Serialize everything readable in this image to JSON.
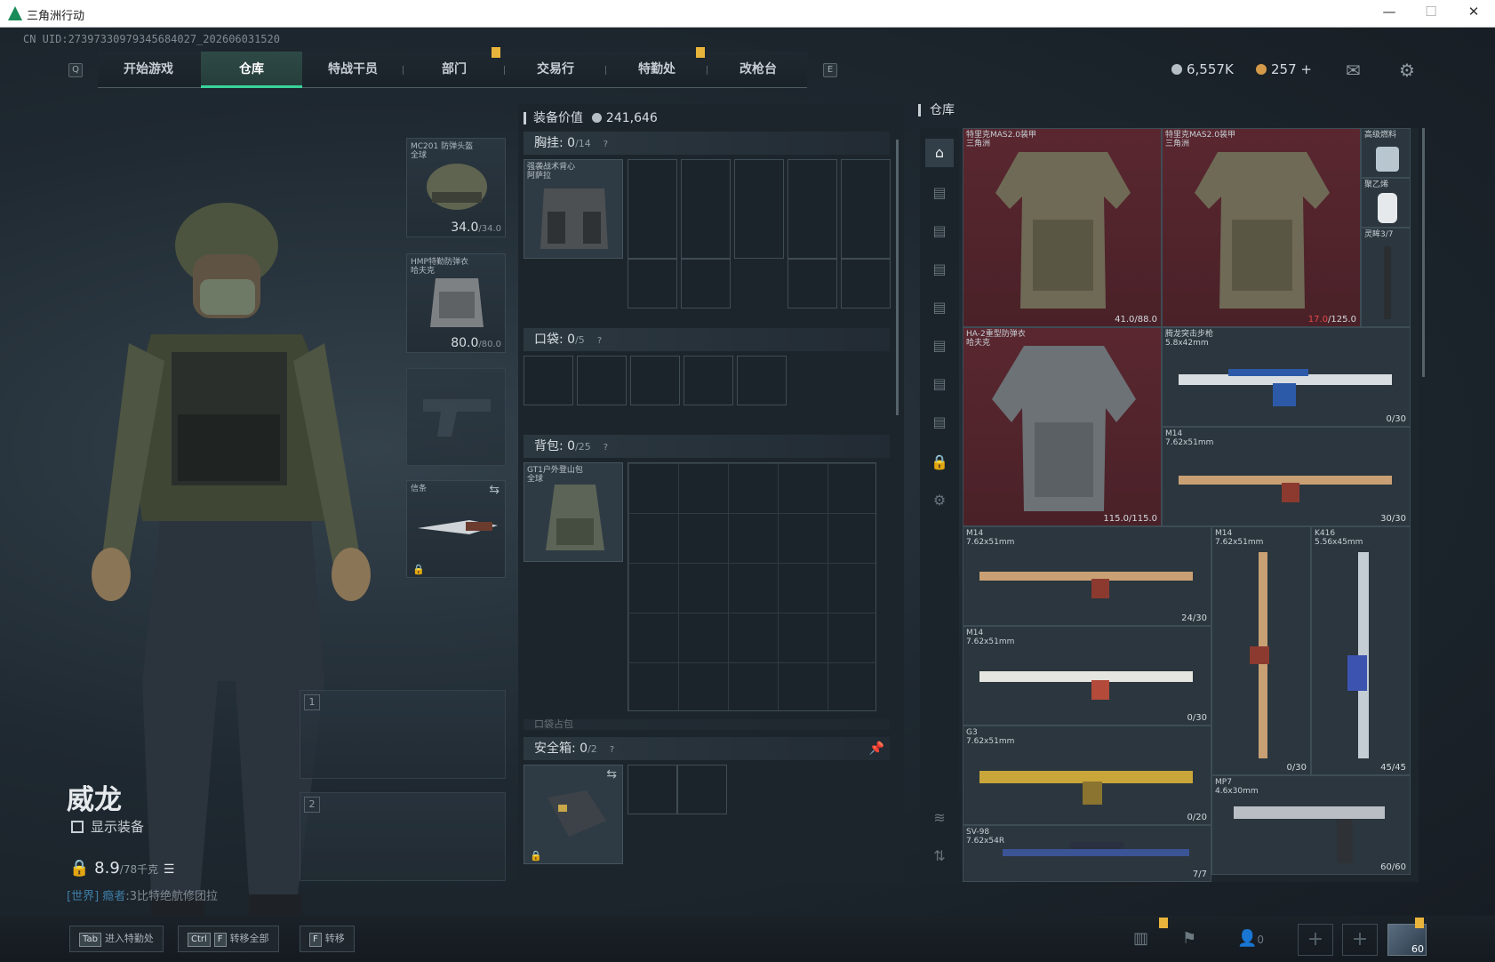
{
  "window": {
    "title": "三角洲行动",
    "min": "—",
    "max": "☐",
    "close": "✕"
  },
  "uid": "CN UID:2739733097934568402​7_202606031520",
  "nav": {
    "left_key": "Q",
    "right_key": "E",
    "tabs": [
      "开始游戏",
      "仓库",
      "特战干员",
      "部门",
      "交易行",
      "特勤处",
      "改枪台"
    ],
    "active": 1
  },
  "currency": {
    "silver": "6,557K",
    "gold": "257",
    "plus": "+"
  },
  "character": {
    "name": "威龙",
    "show_equipment": "显示装备",
    "weight": "8.9",
    "weight_max": "/78千克"
  },
  "world_msg": {
    "tag": "[世界]",
    "name": "瘾者",
    "text": ":3比特绝航修团拉"
  },
  "slots": {
    "helmet": {
      "label1": "MC201 防弹头盔",
      "label2": "全球",
      "dur": "34.0",
      "max": "/34.0"
    },
    "armor": {
      "label1": "HMP特勤防弹衣",
      "label2": "哈夫克",
      "dur": "80.0",
      "max": "/80.0"
    },
    "melee": {
      "label": "信条"
    },
    "weapon1": "1",
    "weapon2": "2"
  },
  "equip_value": {
    "label": "装备价值",
    "value": "241,646"
  },
  "sections": {
    "chest": {
      "label": "胸挂:",
      "count": "0",
      "max": "/14",
      "item_l1": "强袭战术背心",
      "item_l2": "阿萨拉"
    },
    "pocket": {
      "label": "口袋:",
      "count": "0",
      "max": "/5"
    },
    "backpack": {
      "label": "背包:",
      "count": "0",
      "max": "/25",
      "item_l1": "GT1户外登山包",
      "item_l2": "全球"
    },
    "hidden": {
      "label": "口袋占包"
    },
    "safe": {
      "label": "安全箱:",
      "count": "0",
      "max": "/2"
    }
  },
  "warehouse": {
    "title": "仓库",
    "items": [
      {
        "l1": "特里克MAS2.0装甲",
        "l2": "三角洲",
        "cnt": "41.0",
        "max": "/88.0",
        "red": ""
      },
      {
        "l1": "特里克MAS2.0装甲",
        "l2": "三角洲",
        "cnt": "",
        "max": "/125.0",
        "red": "17.0"
      },
      {
        "l1": "高级燃料",
        "l2": "",
        "cnt": "",
        "max": "",
        "red": ""
      },
      {
        "l1": "聚乙烯",
        "l2": "",
        "cnt": "",
        "max": "",
        "red": ""
      },
      {
        "l1": "灵眸3/7",
        "l2": "",
        "cnt": "",
        "max": "",
        "red": ""
      },
      {
        "l1": "HA-2重型防弹衣",
        "l2": "哈夫克",
        "cnt": "115.0",
        "max": "/115.0",
        "red": ""
      },
      {
        "l1": "腾龙突击步枪",
        "l2": "5.8x42mm",
        "cnt": "0",
        "max": "/30",
        "red": ""
      },
      {
        "l1": "M14",
        "l2": "7.62x51mm",
        "cnt": "30",
        "max": "/30",
        "red": ""
      },
      {
        "l1": "M14",
        "l2": "7.62x51mm",
        "cnt": "24",
        "max": "/30",
        "red": ""
      },
      {
        "l1": "M14",
        "l2": "7.62x51mm",
        "cnt": "0",
        "max": "/30",
        "red": ""
      },
      {
        "l1": "K416",
        "l2": "5.56x45mm",
        "cnt": "45",
        "max": "/45",
        "red": ""
      },
      {
        "l1": "M14",
        "l2": "7.62x51mm",
        "cnt": "0",
        "max": "/30",
        "red": ""
      },
      {
        "l1": "G3",
        "l2": "7.62x51mm",
        "cnt": "0",
        "max": "/20",
        "red": ""
      },
      {
        "l1": "MP7",
        "l2": "4.6x30mm",
        "cnt": "60",
        "max": "/60",
        "red": ""
      },
      {
        "l1": "SV-98",
        "l2": "7.62x54R",
        "cnt": "7",
        "max": "/7",
        "red": ""
      }
    ]
  },
  "bottom": {
    "hint1_key": "Tab",
    "hint1": "进入特勤处",
    "hint2_key1": "Ctrl",
    "hint2_key2": "F",
    "hint2": "转移全部",
    "hint3_key": "F",
    "hint3": "转移",
    "team_count": "0",
    "avatar_level": "60"
  }
}
